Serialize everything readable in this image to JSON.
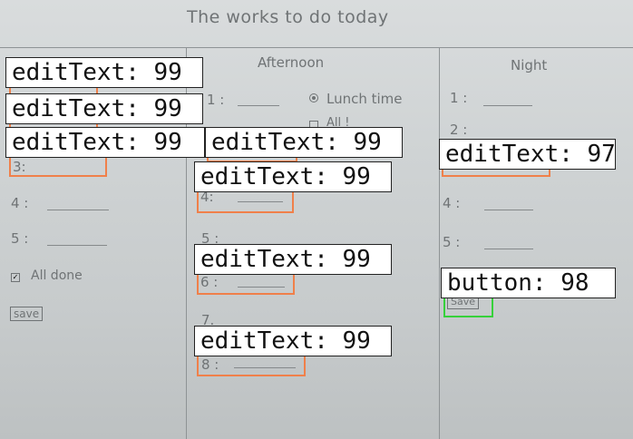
{
  "paper": {
    "title": "The works to do today",
    "columns": {
      "afternoon": "Afternoon",
      "night": "Night"
    }
  },
  "morning": {
    "line3": "3:",
    "line4": "4 :",
    "line5": "5 :",
    "all_done": "All done",
    "save": "save"
  },
  "afternoon": {
    "line1": "1 :",
    "lunch": "Lunch time",
    "all": "All !",
    "line4": "4:",
    "line5": "5 :",
    "line6": "6 :",
    "line7": "7.",
    "line8": "8 :"
  },
  "night": {
    "line1": "1 :",
    "line2": "2 :",
    "line4": "4 :",
    "line5": "5 :",
    "save": "Save"
  },
  "annotations": [
    {
      "label": "editText: 99"
    },
    {
      "label": "editText: 99"
    },
    {
      "label": "editText: 99"
    },
    {
      "label": "editText: 99"
    },
    {
      "label": "editText: 99"
    },
    {
      "label": "editText: 99"
    },
    {
      "label": "editText: 99"
    },
    {
      "label": "editText: 97"
    },
    {
      "label": "button: 98"
    }
  ],
  "colors": {
    "edit_text_box": "#f0804a",
    "button_box": "#36d13a"
  }
}
